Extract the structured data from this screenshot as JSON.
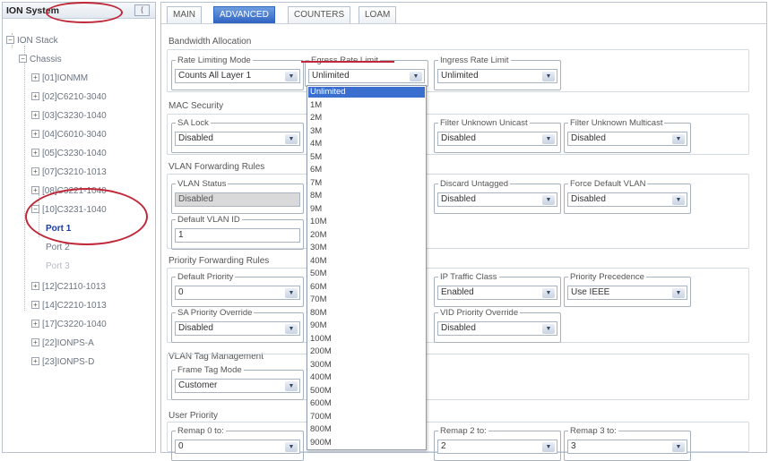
{
  "left_panel": {
    "title": "ION System",
    "collapse_glyph": "⟨",
    "tree": [
      {
        "label": "ION Stack",
        "toggle": "−"
      },
      {
        "label": "Chassis",
        "toggle": "−"
      },
      {
        "label": "[01]IONMM",
        "toggle": "+"
      },
      {
        "label": "[02]C6210-3040",
        "toggle": "+"
      },
      {
        "label": "[03]C3230-1040",
        "toggle": "+"
      },
      {
        "label": "[04]C6010-3040",
        "toggle": "+"
      },
      {
        "label": "[05]C3230-1040",
        "toggle": "+"
      },
      {
        "label": "[07]C3210-1013",
        "toggle": "+"
      },
      {
        "label": "[08]C3221-1040",
        "toggle": "+"
      },
      {
        "label": "[10]C3231-1040",
        "toggle": "−"
      },
      {
        "label": "Port 1",
        "toggle": ""
      },
      {
        "label": "Port 2",
        "toggle": ""
      },
      {
        "label": "Port 3",
        "toggle": ""
      },
      {
        "label": "[12]C2110-1013",
        "toggle": "+"
      },
      {
        "label": "[14]C2210-1013",
        "toggle": "+"
      },
      {
        "label": "[17]C3220-1040",
        "toggle": "+"
      },
      {
        "label": "[22]IONPS-A",
        "toggle": "+"
      },
      {
        "label": "[23]IONPS-D",
        "toggle": "+"
      }
    ]
  },
  "tabs": [
    "MAIN",
    "ADVANCED",
    "COUNTERS",
    "LOAM"
  ],
  "sections": {
    "bandwidth": "Bandwidth Allocation",
    "mac": "MAC Security",
    "vlan_fwd": "VLAN Forwarding Rules",
    "priority_fwd": "Priority Forwarding Rules",
    "vlan_tag": "VLAN Tag Management",
    "user_priority": "User Priority"
  },
  "fields": {
    "rate_limiting_mode": {
      "label": "Rate Limiting Mode",
      "value": "Counts All Layer 1"
    },
    "egress_rate_limit": {
      "label": "Egress Rate Limit",
      "value": "Unlimited"
    },
    "ingress_rate_limit": {
      "label": "Ingress Rate Limit",
      "value": "Unlimited"
    },
    "sa_lock": {
      "label": "SA Lock",
      "value": "Disabled"
    },
    "filter_unknown_unicast": {
      "label": "Filter Unknown Unicast",
      "value": "Disabled"
    },
    "filter_unknown_multicast": {
      "label": "Filter Unknown Multicast",
      "value": "Disabled"
    },
    "vlan_status": {
      "label": "VLAN Status",
      "value": "Disabled"
    },
    "discard_untagged": {
      "label": "Discard Untagged",
      "value": "Disabled"
    },
    "force_default_vlan": {
      "label": "Force Default VLAN",
      "value": "Disabled"
    },
    "default_vlan_id": {
      "label": "Default VLAN ID",
      "value": "1"
    },
    "default_priority": {
      "label": "Default Priority",
      "value": "0"
    },
    "ip_traffic_class": {
      "label": "IP Traffic Class",
      "value": "Enabled"
    },
    "priority_precedence": {
      "label": "Priority Precedence",
      "value": "Use IEEE"
    },
    "sa_priority_override": {
      "label": "SA Priority Override",
      "value": "Disabled"
    },
    "vid_priority_override": {
      "label": "VID Priority Override",
      "value": "Disabled"
    },
    "frame_tag_mode": {
      "label": "Frame Tag Mode",
      "value": "Customer"
    },
    "remap_0": {
      "label": "Remap 0 to:",
      "value": "0"
    },
    "remap_2": {
      "label": "Remap 2 to:",
      "value": "2"
    },
    "remap_3": {
      "label": "Remap 3 to:",
      "value": "3"
    }
  },
  "dropdown_options": [
    "Unlimited",
    "1M",
    "2M",
    "3M",
    "4M",
    "5M",
    "6M",
    "7M",
    "8M",
    "9M",
    "10M",
    "20M",
    "30M",
    "40M",
    "50M",
    "60M",
    "70M",
    "80M",
    "90M",
    "100M",
    "200M",
    "300M",
    "400M",
    "500M",
    "600M",
    "700M",
    "800M",
    "900M"
  ],
  "dropdown_selected_index": 0,
  "icons": {
    "dropdown_arrow": "▼"
  },
  "colors": {
    "accent": "#2f62c2",
    "highlight": "#3a6fd0",
    "annotation": "#c0283a"
  }
}
